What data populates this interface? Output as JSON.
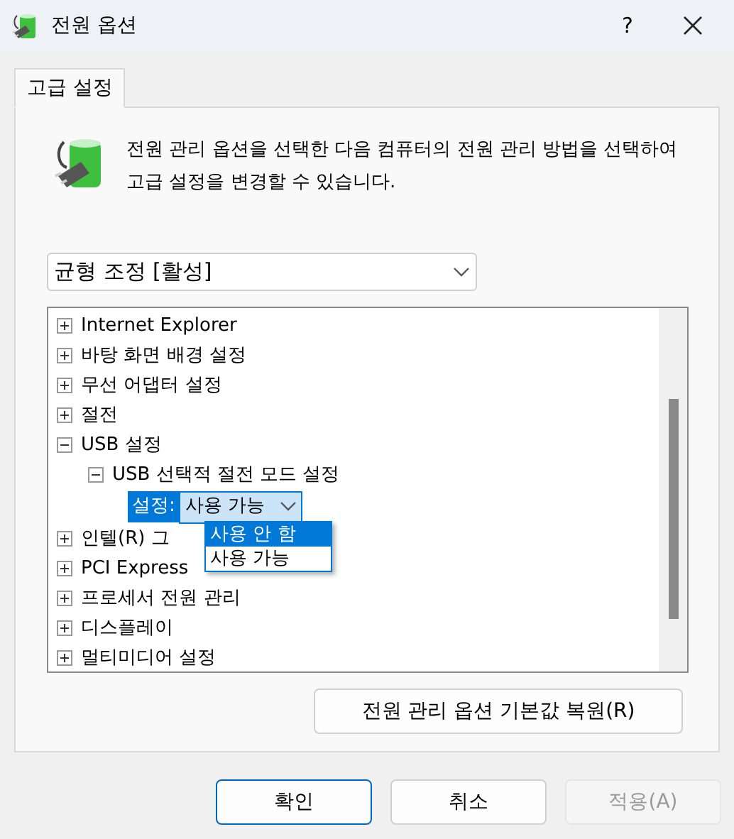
{
  "window": {
    "title": "전원 옵션",
    "help_button": "?"
  },
  "tabs": [
    {
      "label": "고급 설정",
      "selected": true
    }
  ],
  "description": "전원 관리 옵션을 선택한 다음 컴퓨터의 전원 관리 방법을 선택하여 고급 설정을 변경할 수 있습니다.",
  "plan_select": {
    "value": "균형 조정 [활성]"
  },
  "tree": [
    {
      "kind": "node",
      "label": "Internet Explorer",
      "expanded": false
    },
    {
      "kind": "node",
      "label": "바탕 화면 배경 설정",
      "expanded": false
    },
    {
      "kind": "node",
      "label": "무선 어댑터 설정",
      "expanded": false
    },
    {
      "kind": "node",
      "label": "절전",
      "expanded": false
    },
    {
      "kind": "node",
      "label": "USB 설정",
      "expanded": true,
      "children": [
        {
          "kind": "node",
          "label": "USB 선택적 절전 모드 설정",
          "expanded": true,
          "children": [
            {
              "kind": "setting",
              "label": "설정:",
              "value": "사용 가능",
              "options": [
                {
                  "label": "사용 안 함",
                  "highlighted": true
                },
                {
                  "label": "사용 가능",
                  "highlighted": false
                }
              ]
            }
          ]
        }
      ]
    },
    {
      "kind": "node",
      "label": "인텔(R) 그",
      "expanded": false
    },
    {
      "kind": "node",
      "label": "PCI Express",
      "expanded": false
    },
    {
      "kind": "node",
      "label": "프로세서 전원 관리",
      "expanded": false
    },
    {
      "kind": "node",
      "label": "디스플레이",
      "expanded": false
    },
    {
      "kind": "node",
      "label": "멀티미디어 설정",
      "expanded": false
    }
  ],
  "restore_button": "전원 관리 옵션 기본값 복원(R)",
  "buttons": [
    {
      "label": "확인",
      "kind": "default",
      "disabled": false
    },
    {
      "label": "취소",
      "kind": "normal",
      "disabled": false
    },
    {
      "label": "적용(A)",
      "kind": "normal",
      "disabled": true
    }
  ]
}
